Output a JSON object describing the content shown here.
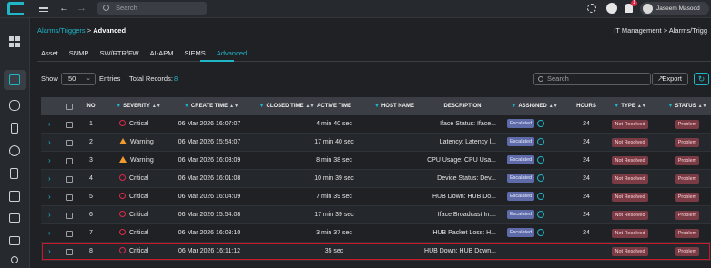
{
  "topbar": {
    "search_placeholder": "Search",
    "user_name": "Jaseem Masood",
    "notification_count": "1"
  },
  "breadcrumb": {
    "parent": "Alarms/Triggers",
    "separator": " > ",
    "current": "Advanced",
    "right_text": "IT Management > Alarms/Trigg"
  },
  "tabs": [
    "Asset",
    "SNMP",
    "SW/RTR/FW",
    "AI-APM",
    "SIEMS",
    "Advanced"
  ],
  "active_tab": "Advanced",
  "controls": {
    "show_label": "Show",
    "show_value": "50",
    "entries_label": "Entries",
    "total_label": "Total Records:",
    "total_value": "8",
    "search_placeholder": "Search",
    "export_label": "Export"
  },
  "table": {
    "headers": [
      "NO",
      "SEVERITY",
      "CREATE TIME",
      "CLOSED TIME",
      "ACTIVE TIME",
      "HOST NAME",
      "DESCRIPTION",
      "ASSIGNED",
      "HOURS",
      "TYPE",
      "STATUS"
    ],
    "rows": [
      {
        "no": "1",
        "severity": "Critical",
        "create_time": "06 Mar 2026 16:07:07",
        "closed_time": "",
        "active_time": "4 min 40 sec",
        "host": "",
        "description": "Iface Status: Iface...",
        "assigned": "Escalated",
        "hours": "24",
        "type": "Not Resolved",
        "status": "Problem"
      },
      {
        "no": "2",
        "severity": "Warning",
        "create_time": "06 Mar 2026 15:54:07",
        "closed_time": "",
        "active_time": "17 min 40 sec",
        "host": "",
        "description": "Latency: Latency l...",
        "assigned": "Escalated",
        "hours": "24",
        "type": "Not Resolved",
        "status": "Problem"
      },
      {
        "no": "3",
        "severity": "Warning",
        "create_time": "06 Mar 2026 16:03:09",
        "closed_time": "",
        "active_time": "8 min 38 sec",
        "host": "",
        "description": "CPU Usage: CPU Usa...",
        "assigned": "Escalated",
        "hours": "24",
        "type": "Not Resolved",
        "status": "Problem"
      },
      {
        "no": "4",
        "severity": "Critical",
        "create_time": "06 Mar 2026 16:01:08",
        "closed_time": "",
        "active_time": "10 min 39 sec",
        "host": "",
        "description": "Device Status: Dev...",
        "assigned": "Escalated",
        "hours": "24",
        "type": "Not Resolved",
        "status": "Problem"
      },
      {
        "no": "5",
        "severity": "Critical",
        "create_time": "06 Mar 2026 16:04:09",
        "closed_time": "",
        "active_time": "7 min 39 sec",
        "host": "",
        "description": "HUB Down: HUB Do...",
        "assigned": "Escalated",
        "hours": "24",
        "type": "Not Resolved",
        "status": "Problem"
      },
      {
        "no": "6",
        "severity": "Critical",
        "create_time": "06 Mar 2026 15:54:08",
        "closed_time": "",
        "active_time": "17 min 39 sec",
        "host": "",
        "description": "Iface Broadcast In:...",
        "assigned": "Escalated",
        "hours": "24",
        "type": "Not Resolved",
        "status": "Problem"
      },
      {
        "no": "7",
        "severity": "Critical",
        "create_time": "06 Mar 2026 16:08:10",
        "closed_time": "",
        "active_time": "3 min 37 sec",
        "host": "",
        "description": "HUB Packet Loss: H...",
        "assigned": "Escalated",
        "hours": "24",
        "type": "Not Resolved",
        "status": "Problem"
      },
      {
        "no": "8",
        "severity": "Critical",
        "create_time": "06 Mar 2026 16:11:12",
        "closed_time": "",
        "active_time": "35 sec",
        "host": "",
        "description": "HUB Down: HUB Down...",
        "assigned": "",
        "hours": "",
        "type": "Not Resolved",
        "status": "Problem"
      }
    ]
  },
  "colors": {
    "accent": "#1fb6c8",
    "critical": "#e0294a",
    "warning": "#f29a2e",
    "highlight_border": "#c8182a"
  }
}
